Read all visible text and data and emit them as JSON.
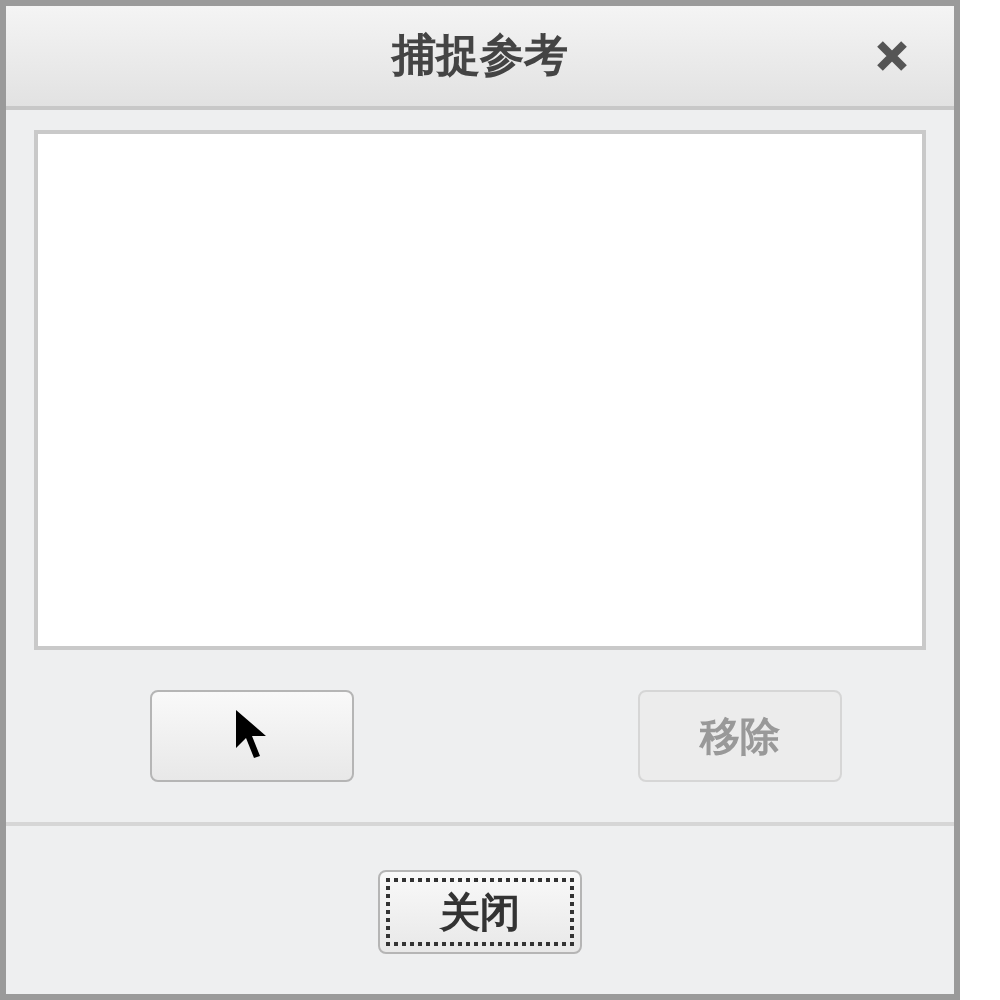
{
  "window": {
    "title": "捕捉参考"
  },
  "remove_button": {
    "label": "移除",
    "disabled": true
  },
  "close_button": {
    "label": "关闭",
    "focused": true
  }
}
